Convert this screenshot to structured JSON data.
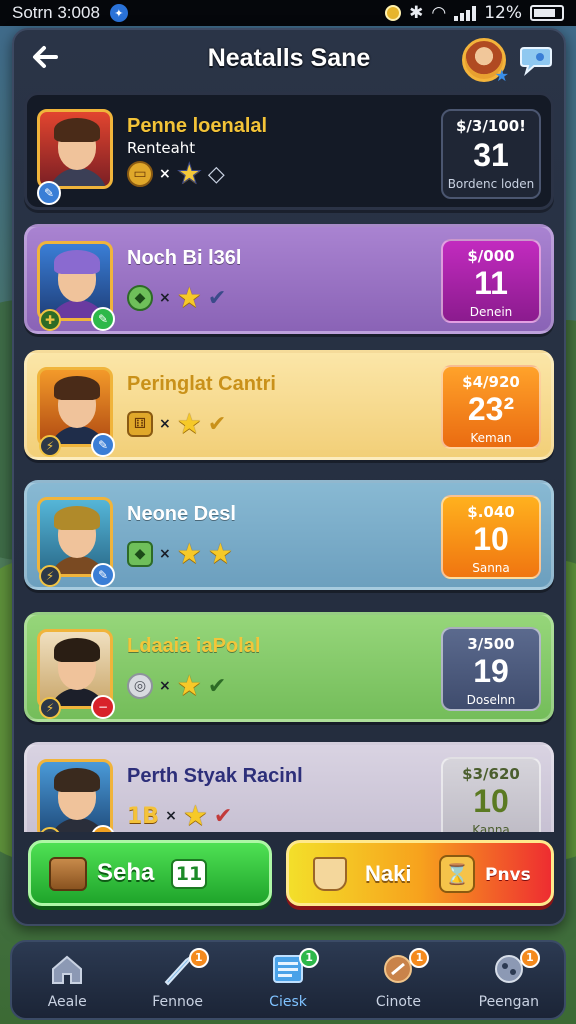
{
  "status_bar": {
    "time": "Sotrn 3:008",
    "battery": "12%"
  },
  "header": {
    "title": "Neatalls Sane"
  },
  "cards": [
    {
      "name": "Penne loenalal",
      "subtitle": "Renteaht",
      "reward_cost": "$/3/100!",
      "reward_amount": "31",
      "reward_label": "Bordenc loden"
    },
    {
      "name": "Noch Bi l36l",
      "subtitle": "",
      "reward_cost": "$/000",
      "reward_amount": "11",
      "reward_label": "Denein"
    },
    {
      "name": "Peringlat Cantri",
      "subtitle": "",
      "reward_cost": "$4/920",
      "reward_amount": "23²",
      "reward_label": "Keman"
    },
    {
      "name": "Neone Desl",
      "subtitle": "",
      "reward_cost": "$.040",
      "reward_amount": "10",
      "reward_label": "Sanna"
    },
    {
      "name": "Ldaaia iaPolal",
      "subtitle": "",
      "reward_cost": "3/500",
      "reward_amount": "19",
      "reward_label": "Doselnn"
    },
    {
      "name": "Perth Styak Racinl",
      "subtitle": "",
      "token_number": "1B",
      "reward_cost": "$3/620",
      "reward_amount": "10",
      "reward_label": "Kanna"
    }
  ],
  "actions": {
    "primary_label": "Seha",
    "primary_count": "11",
    "secondary_label": "Naki",
    "secondary_label2": "Pnvs"
  },
  "bottom_nav": [
    {
      "label": "Aeale",
      "badge": ""
    },
    {
      "label": "Fennoe",
      "badge": "1"
    },
    {
      "label": "Ciesk",
      "badge": "1",
      "active": true
    },
    {
      "label": "Cinote",
      "badge": "1"
    },
    {
      "label": "Peengan",
      "badge": "1"
    }
  ],
  "colors": {
    "primary_button": "#2fb83a",
    "active_nav": "#7fc2ff",
    "accent_gold": "#f3c338"
  }
}
